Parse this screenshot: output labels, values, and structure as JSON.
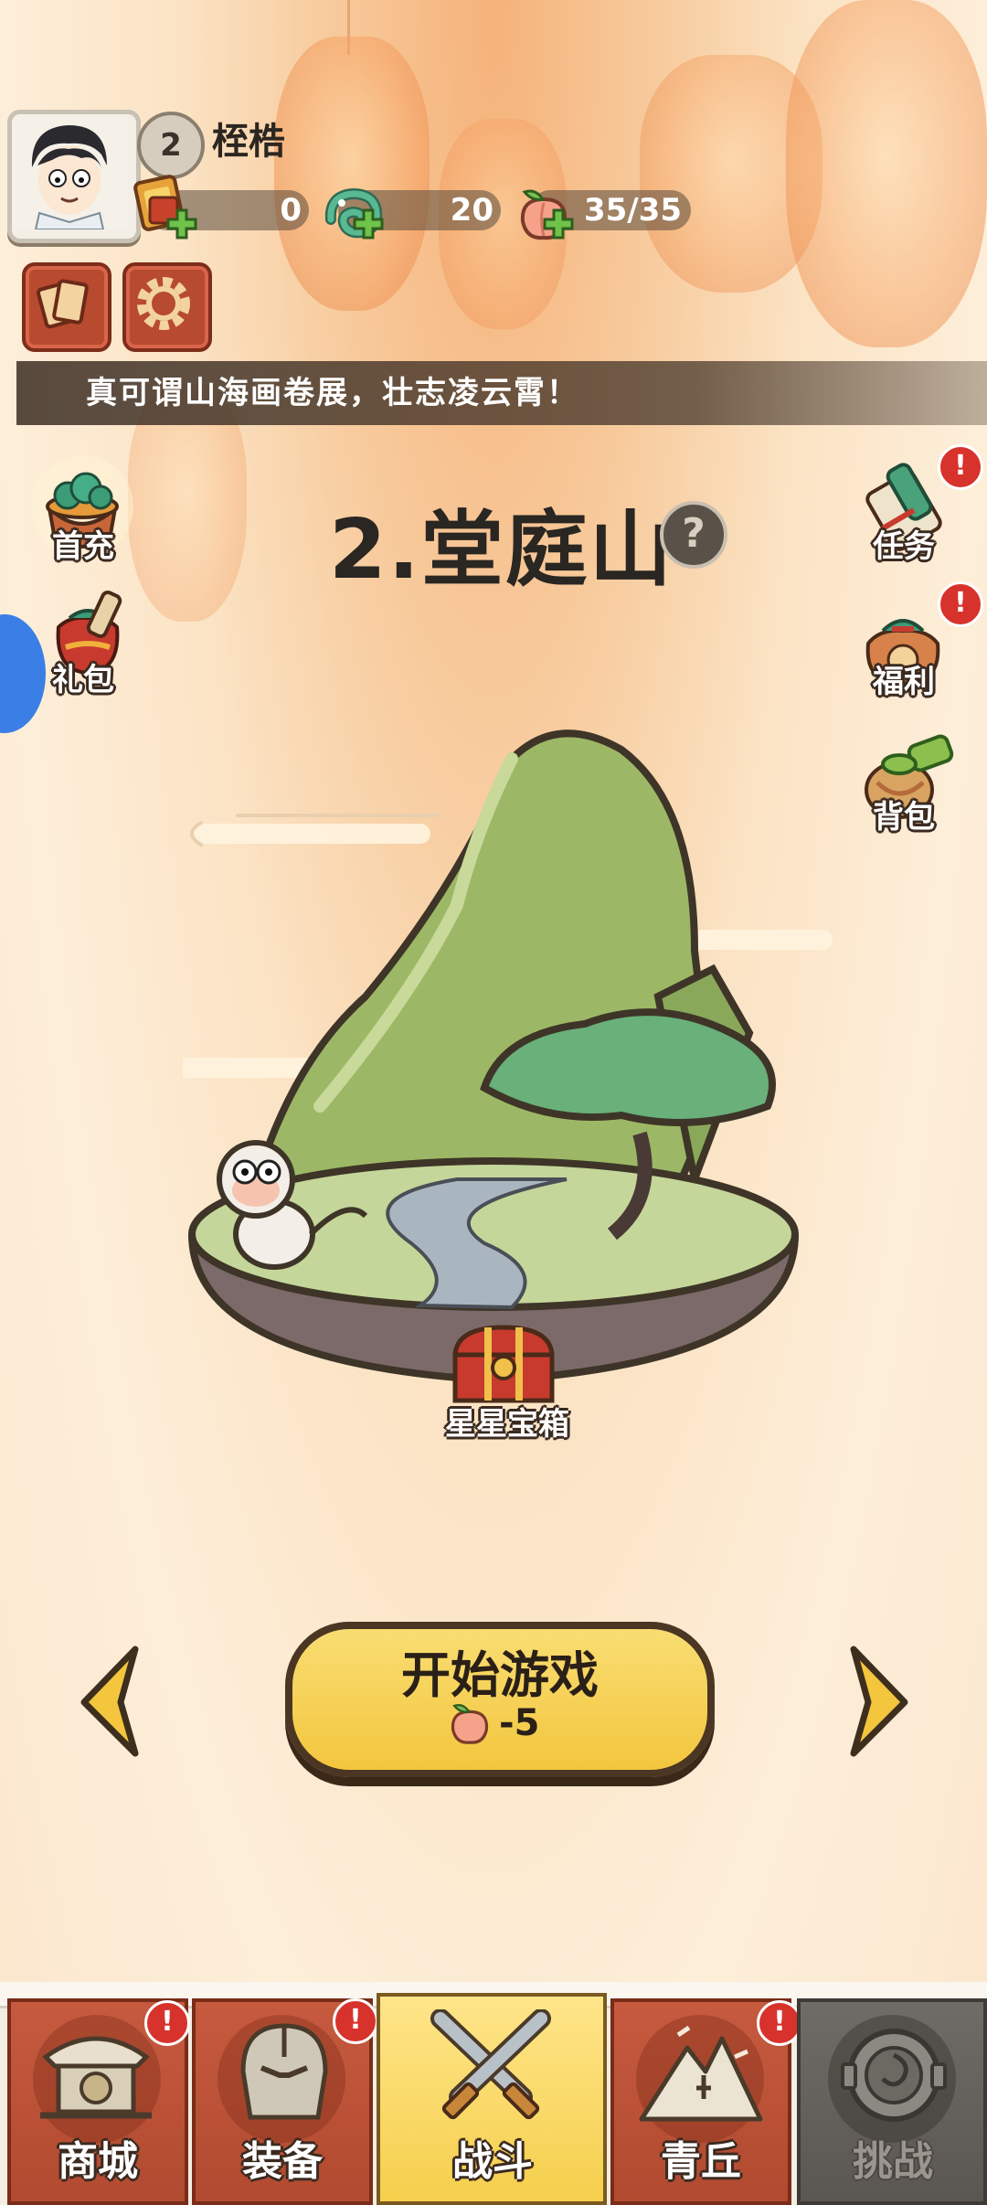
{
  "player": {
    "level": "2",
    "name": "桎梏"
  },
  "resources": [
    {
      "icon": "gold-ticket-icon",
      "value": "0"
    },
    {
      "icon": "jade-dragon-icon",
      "value": "20"
    },
    {
      "icon": "peach-stamina-icon",
      "value": "35/35"
    }
  ],
  "banner_text": "真可谓山海画卷展，壮志凌云霄！",
  "left_menu": [
    {
      "label": "首充",
      "icon": "treasure-pot-icon"
    },
    {
      "label": "礼包",
      "icon": "gift-bag-icon"
    }
  ],
  "right_menu": [
    {
      "label": "任务",
      "icon": "scroll-icon",
      "alert": "!"
    },
    {
      "label": "福利",
      "icon": "lucky-bag-icon",
      "alert": "!"
    },
    {
      "label": "背包",
      "icon": "bundle-icon"
    }
  ],
  "stage": {
    "title": "2.堂庭山",
    "help": "?",
    "chest_label": "星星宝箱"
  },
  "start_button": {
    "label": "开始游戏",
    "cost": "-5"
  },
  "nav": [
    {
      "label": "商城",
      "icon": "shop-icon",
      "alert": "!",
      "state": "normal"
    },
    {
      "label": "装备",
      "icon": "helmet-icon",
      "alert": "!",
      "state": "normal"
    },
    {
      "label": "战斗",
      "icon": "crossed-swords-icon",
      "alert": "",
      "state": "active"
    },
    {
      "label": "青丘",
      "icon": "mountain-icon",
      "alert": "!",
      "state": "normal"
    },
    {
      "label": "挑战",
      "icon": "spiral-gate-icon",
      "alert": "",
      "state": "locked"
    }
  ],
  "colors": {
    "accent_yellow": "#f5cf4c",
    "nav_red": "#b14a30",
    "alert_red": "#d8322c",
    "text_dark": "#2a2622"
  }
}
